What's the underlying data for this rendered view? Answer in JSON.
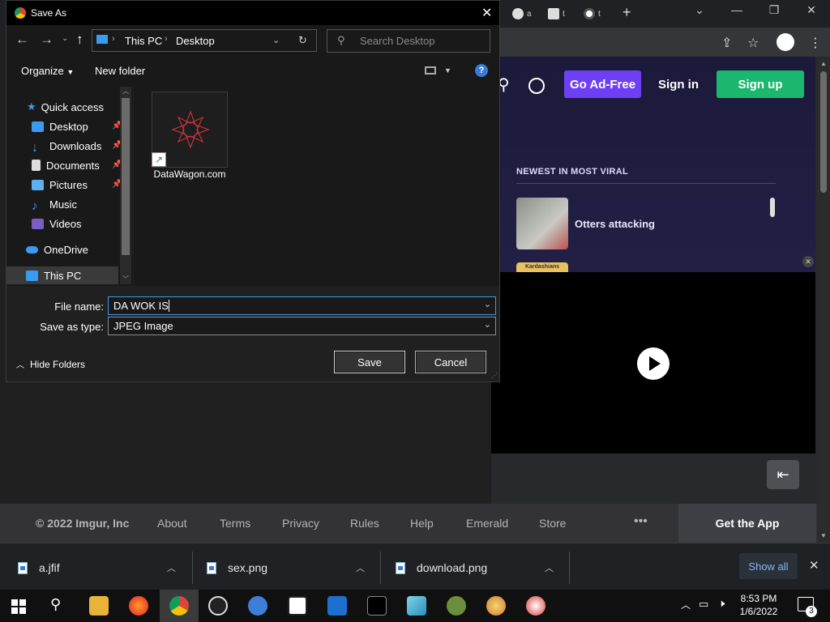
{
  "dialog": {
    "title": "Save As",
    "close_glyph": "✕",
    "breadcrumb": [
      "This PC",
      "Desktop"
    ],
    "search_placeholder": "Search Desktop",
    "toolbar": {
      "organize": "Organize",
      "new_folder": "New folder"
    },
    "tree": {
      "quick_access": "Quick access",
      "items": [
        "Desktop",
        "Downloads",
        "Documents",
        "Pictures",
        "Music",
        "Videos"
      ],
      "onedrive": "OneDrive",
      "this_pc": "This PC"
    },
    "files": [
      {
        "name": "DataWagon.com"
      }
    ],
    "file_name_label": "File name:",
    "file_name_value": "DA WOK IS ",
    "save_type_label": "Save as type:",
    "save_type_value": "JPEG Image",
    "hide_folders": "Hide Folders",
    "save": "Save",
    "cancel": "Cancel"
  },
  "browser": {
    "tabs": [
      "a",
      "t",
      "t"
    ],
    "new_tab": "+"
  },
  "imgur": {
    "go_ad_free": "Go Ad-Free",
    "sign_in": "Sign in",
    "sign_up": "Sign up",
    "section_title": "NEWEST IN MOST VIRAL",
    "post_title": "Otters attacking",
    "thumb_label": "Kardashians",
    "footer": {
      "copyright": "© 2022 Imgur, Inc",
      "links": [
        "About",
        "Terms",
        "Privacy",
        "Rules",
        "Help",
        "Emerald",
        "Store"
      ],
      "more": "•••",
      "get_app": "Get the App"
    }
  },
  "downloads": {
    "items": [
      "a.jfif",
      "sex.png",
      "download.png"
    ],
    "show_all": "Show all"
  },
  "taskbar": {
    "time": "8:53 PM",
    "date": "1/6/2022",
    "notification_count": "3"
  },
  "colors": {
    "ad_free": "#6f3ff5",
    "sign_up": "#1bb76e",
    "accent_blue": "#3a9bf0"
  }
}
